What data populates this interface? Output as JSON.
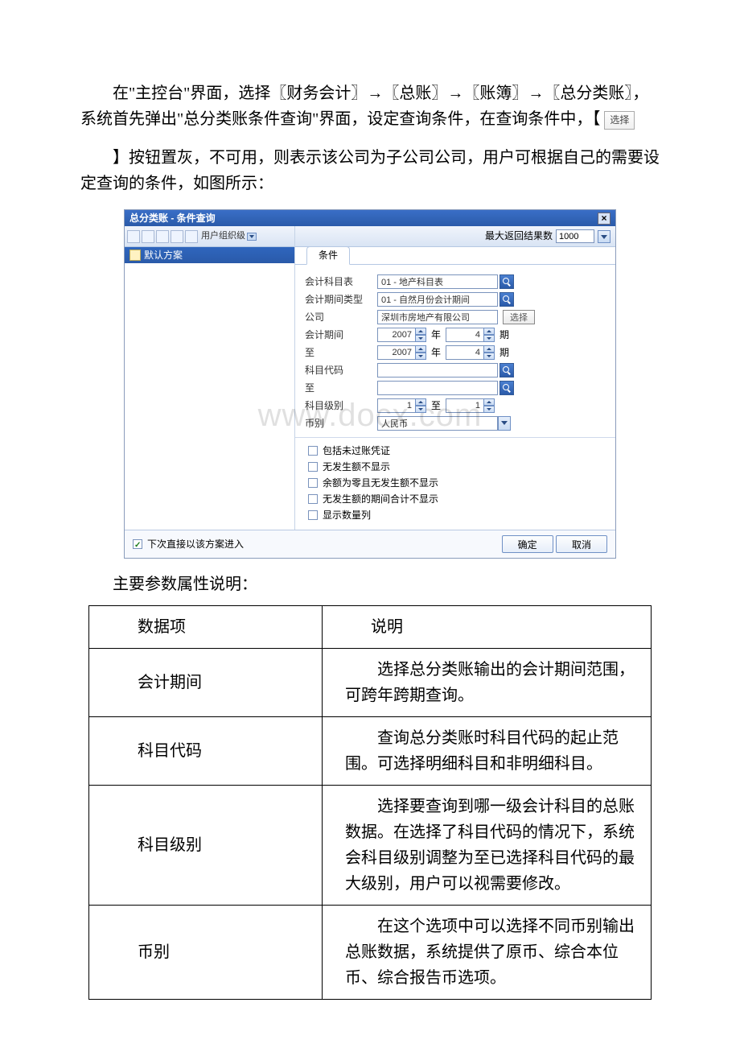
{
  "para1_a": "在\"主控台\"界面，选择〖财务会计〗→〖总账〗→〖账簿〗→〖总分类账〗，系统首先弹出\"总分类账条件查询\"界面，设定查询条件，在查询条件中，【",
  "select_btn_label": "选择",
  "para2": "】按钮置灰，不可用，则表示该公司为子公司公司，用户可根据自己的需要设定查询的条件，如图所示：",
  "dialog": {
    "title": "总分类账 - 条件查询",
    "close_label": "×",
    "toolbar_label": "用户组织级",
    "default_plan": "默认方案",
    "max_return_label": "最大返回结果数",
    "max_return_value": "1000",
    "tab_label": "条件",
    "rows": {
      "r1_label": "会计科目表",
      "r1_value": "01 - 地产科目表",
      "r2_label": "会计期间类型",
      "r2_value": "01 - 自然月份会计期间",
      "r3_label": "公司",
      "r3_value": "深圳市房地产有限公司",
      "r3_btn": "选择",
      "r4_label": "会计期间",
      "r4_year": "2007",
      "r4_yearunit": "年",
      "r4_period": "4",
      "r4_periodunit": "期",
      "r5_label": "至",
      "r5_year": "2007",
      "r5_yearunit": "年",
      "r5_period": "4",
      "r5_periodunit": "期",
      "r6_label": "科目代码",
      "r7_label": "至",
      "r8_label": "科目级别",
      "r8_from": "1",
      "r8_tolabel": "至",
      "r8_to": "1",
      "r9_label": "币别",
      "r9_value": "人民币"
    },
    "checks": {
      "c1": "包括未过账凭证",
      "c2": "无发生额不显示",
      "c3": "余额为零且无发生额不显示",
      "c4": "无发生额的期间合计不显示",
      "c5": "显示数量列"
    },
    "footer": {
      "next_time": "下次直接以该方案进入",
      "ok": "确定",
      "cancel": "取消"
    }
  },
  "watermark": "www.docx.com",
  "subheading": "主要参数属性说明：",
  "table": {
    "h1": "数据项",
    "h2": "说明",
    "rows": [
      {
        "k": "会计期间",
        "v": "选择总分类账输出的会计期间范围，可跨年跨期查询。"
      },
      {
        "k": "科目代码",
        "v": "查询总分类账时科目代码的起止范围。可选择明细科目和非明细科目。"
      },
      {
        "k": "科目级别",
        "v": "选择要查询到哪一级会计科目的总账数据。在选择了科目代码的情况下，系统会科目级别调整为至已选择科目代码的最大级别，用户可以视需要修改。"
      },
      {
        "k": "币别",
        "v": "在这个选项中可以选择不同币别输出总账数据，系统提供了原币、综合本位币、综合报告币选项。"
      }
    ]
  }
}
